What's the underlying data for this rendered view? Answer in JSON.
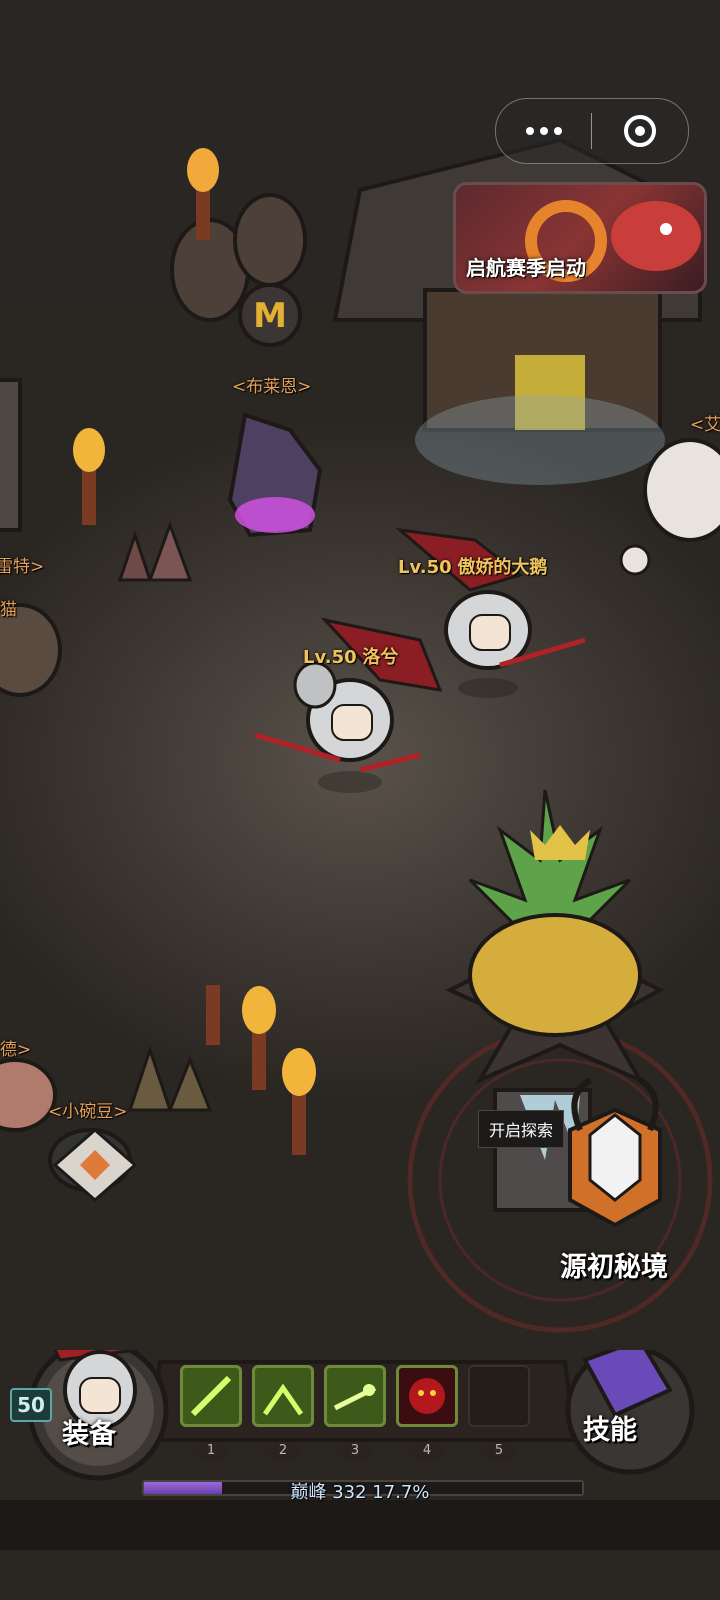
{
  "capsule": {
    "more_icon": "more-dots-icon",
    "close_icon": "target-circle-icon"
  },
  "banner": {
    "title": "启航赛季启动"
  },
  "npcs": {
    "bulaien": "<布莱恩>",
    "lei_te": "雷特>",
    "mao": "猫",
    "ai": "<艾",
    "de": "德>",
    "xiaowandou": "<小碗豆>"
  },
  "players": [
    {
      "level": "Lv.50",
      "name": "傲娇的大鹅"
    },
    {
      "level": "Lv.50",
      "name": "洛兮"
    }
  ],
  "exploration": {
    "prompt": "开启探索",
    "portal_label": "源初秘境"
  },
  "hud": {
    "player_level": "50",
    "equip_label": "装备",
    "skill_label": "技能",
    "skill_slots": [
      "1",
      "2",
      "3",
      "4",
      "5"
    ],
    "xp_text": "巅峰 332  17.7%",
    "xp_progress": 0.177,
    "colors": {
      "xp_fill": "#7a4cc2",
      "slot_border": "#6f8a38",
      "label_orange": "#e4a15a",
      "label_gold": "#f0c45c"
    }
  }
}
